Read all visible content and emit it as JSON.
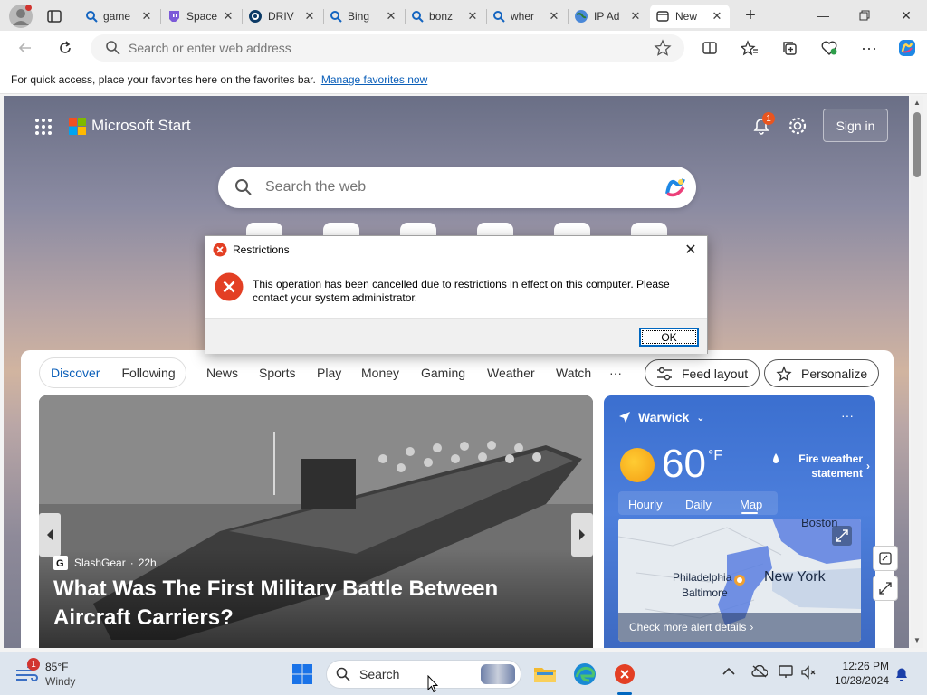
{
  "tabs": [
    {
      "title": "game",
      "icon": "search-icon",
      "active": false
    },
    {
      "title": "Space",
      "icon": "twitch-icon",
      "active": false
    },
    {
      "title": "DRIV",
      "icon": "disc-icon",
      "active": false
    },
    {
      "title": "Bing",
      "icon": "search-icon",
      "active": false
    },
    {
      "title": "bonz",
      "icon": "search-icon",
      "active": false
    },
    {
      "title": "wher",
      "icon": "search-icon",
      "active": false
    },
    {
      "title": "IP Ad",
      "icon": "globe-icon",
      "active": false
    },
    {
      "title": "New",
      "icon": "newtab-icon",
      "active": true
    }
  ],
  "toolbar": {
    "address_placeholder": "Search or enter web address"
  },
  "favorites_bar": {
    "message": "For quick access, place your favorites here on the favorites bar.",
    "link": "Manage favorites now"
  },
  "msn": {
    "brand": "Microsoft Start",
    "notification_count": "1",
    "sign_in": "Sign in",
    "search_placeholder": "Search the web"
  },
  "dialog": {
    "title": "Restrictions",
    "message": "This operation has been cancelled due to restrictions in effect on this computer. Please contact your system administrator.",
    "ok": "OK"
  },
  "feed": {
    "pill": {
      "discover": "Discover",
      "following": "Following"
    },
    "nav": [
      "News",
      "Sports",
      "Play",
      "Money",
      "Gaming",
      "Weather",
      "Watch",
      "···"
    ],
    "feed_layout": "Feed layout",
    "personalize": "Personalize",
    "hero": {
      "source": "SlashGear",
      "age": "22h",
      "headline": "What Was The First Military Battle Between Aircraft Carriers?"
    },
    "weather": {
      "location": "Warwick",
      "temp": "60",
      "unit": "°F",
      "alert": "Fire weather statement",
      "tabs": [
        "Hourly",
        "Daily",
        "Map"
      ],
      "map_labels": {
        "boston": "Boston",
        "new_york": "New York",
        "philadelphia": "Philadelphia",
        "baltimore": "Baltimore"
      },
      "alert_link": "Check more alert details"
    }
  },
  "taskbar": {
    "weather_temp": "85°F",
    "weather_desc": "Windy",
    "weather_badge": "1",
    "search_label": "Search",
    "time": "12:26 PM",
    "date": "10/28/2024"
  },
  "colors": {
    "accent": "#0067c0",
    "error": "#e33f24",
    "weather_bg": "#3b6fcf"
  }
}
